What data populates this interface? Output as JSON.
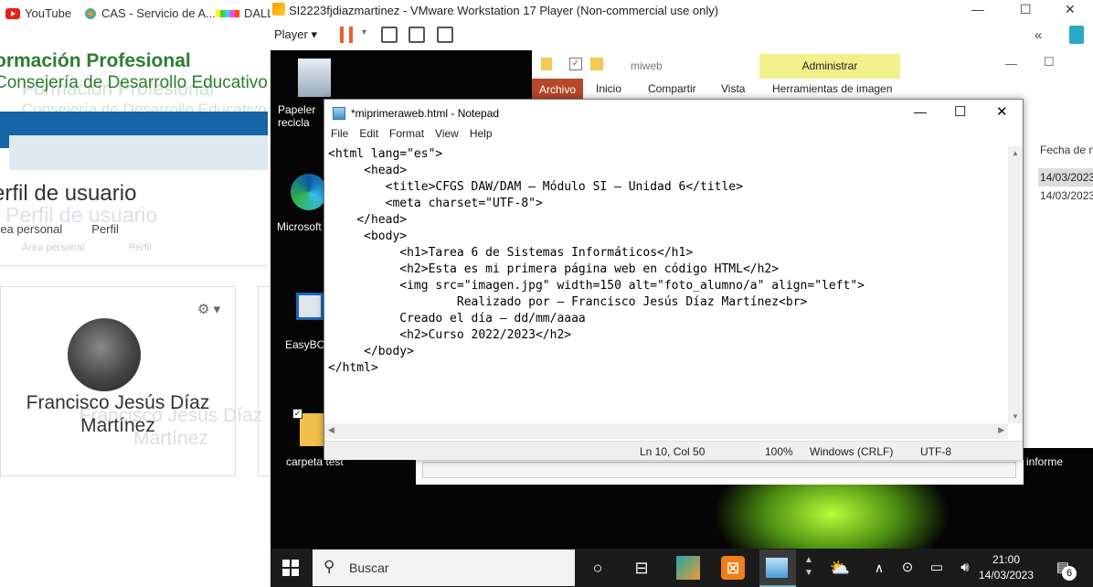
{
  "browser": {
    "bookmarks": [
      "YouTube",
      "CAS - Servicio de A...",
      "DALL"
    ],
    "site_title1": "ormación Profesional",
    "site_title2": "Consejería de Desarrollo Educativo",
    "site_title1_ghost": "Formación Profesional",
    "site_title2_ghost": "Consejería de Desarrollo Educativo",
    "page_title": "erfil de usuario",
    "page_title_ghost": "Perfil de usuario",
    "breadcrumb_1": "rea personal",
    "breadcrumb_2": "Perfil",
    "breadcrumb_ghost_1": "Área personal",
    "breadcrumb_ghost_2": "Perfil",
    "user_name": "Francisco Jesús Díaz Martínez",
    "user_name_ghost": "Francisco Jesús Díaz Martínez"
  },
  "vmware": {
    "title": "SI2223fjdiazmartinez - VMware Workstation 17 Player (Non-commercial use only)",
    "player_label": "Player",
    "minimize": "—",
    "maximize": "☐",
    "close": "✕",
    "collapse": "«"
  },
  "desktop": {
    "icons": [
      "Papelera de reciclaje",
      "Microsoft Edge",
      "EasyBCD",
      "carpeta test"
    ],
    "icon_labels_visible": [
      "Papeler recicla",
      "Microsoft",
      "EasyBCD",
      "carpeta test"
    ],
    "informe_label": "informe"
  },
  "explorer": {
    "path": "miweb",
    "tabs": [
      "Archivo",
      "Inicio",
      "Compartir",
      "Vista",
      "Herramientas de imagen"
    ],
    "context_tab": "Administrar",
    "column": "Fecha de m",
    "dates": [
      "14/03/2023",
      "14/03/2023"
    ]
  },
  "notepad": {
    "title": "*miprimeraweb.html - Notepad",
    "menu": [
      "File",
      "Edit",
      "Format",
      "View",
      "Help"
    ],
    "code": "<html lang=\"es\">\n     <head>\n        <title>CFGS DAW/DAM – Módulo SI – Unidad 6</title>\n        <meta charset=\"UTF-8\">\n    </head>\n     <body>\n          <h1>Tarea 6 de Sistemas Informáticos</h1>\n          <h2>Esta es mi primera página web en código HTML</h2>\n          <img src=\"imagen.jpg\" width=150 alt=\"foto_alumno/a\" align=\"left\">\n                  Realizado por – Francisco Jesús Díaz Martínez<br>\n          Creado el día – dd/mm/aaaa\n          <h2>Curso 2022/2023</h2>\n     </body>\n</html>",
    "status": {
      "position": "Ln 10, Col 50",
      "zoom": "100%",
      "line_ending": "Windows (CRLF)",
      "encoding": "UTF-8"
    }
  },
  "taskbar": {
    "search_placeholder": "Buscar",
    "time": "21:00",
    "date": "14/03/2023",
    "notification_count": "6"
  }
}
